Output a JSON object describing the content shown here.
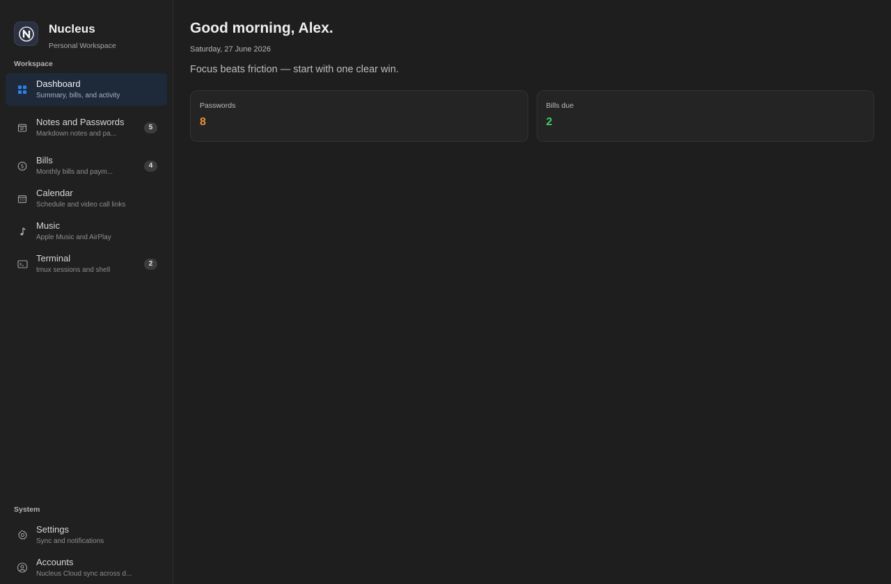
{
  "app": {
    "name": "Nucleus",
    "workspace": "Personal Workspace"
  },
  "sidebar": {
    "workspace_label": "Workspace",
    "system_label": "System",
    "items": [
      {
        "title": "Dashboard",
        "desc": "Summary, bills, and activity",
        "icon": "grid-icon",
        "active": true
      },
      {
        "title": "Notes and Passwords",
        "desc": "Markdown notes and pa...",
        "icon": "notes-icon",
        "badge": "5"
      },
      {
        "title": "Bills",
        "desc": "Monthly bills and paym...",
        "icon": "dollar-circle-icon",
        "badge": "4"
      },
      {
        "title": "Calendar",
        "desc": "Schedule and video call links",
        "icon": "calendar-icon"
      },
      {
        "title": "Music",
        "desc": "Apple Music and AirPlay",
        "icon": "music-note-icon"
      },
      {
        "title": "Terminal",
        "desc": "tmux sessions and shell",
        "icon": "terminal-icon",
        "badge": "2"
      }
    ],
    "system_items": [
      {
        "title": "Settings",
        "desc": "Sync and notifications",
        "icon": "gear-icon"
      },
      {
        "title": "Accounts",
        "desc": "Nucleus Cloud sync across d...",
        "icon": "accounts-icon"
      }
    ]
  },
  "main": {
    "greeting": "Good morning, Alex.",
    "date": "Saturday, 27 June 2026",
    "tagline": "Focus beats friction — start with one clear win.",
    "stats": [
      {
        "label": "Passwords",
        "value": "8",
        "color": "#f0923a"
      },
      {
        "label": "Bills due",
        "value": "2",
        "color": "#3fcf63"
      }
    ]
  },
  "colors": {
    "accent": "#2f80ed",
    "background": "#1e1e1e",
    "sidebar_active": "#1e2a3a"
  }
}
